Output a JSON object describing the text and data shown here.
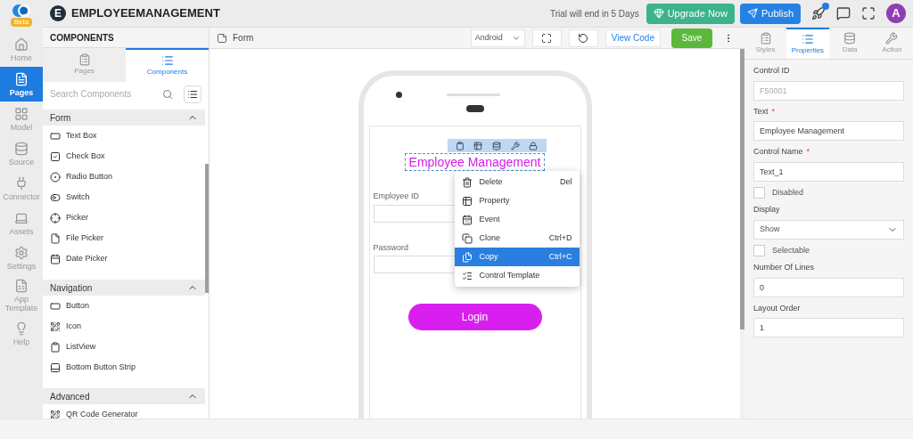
{
  "app": {
    "logo_badge": "Beta",
    "title_initial": "E",
    "title": "EMPLOYEEMANAGEMENT"
  },
  "topbar": {
    "trial_text": "Trial will end in 5 Days",
    "upgrade_button": "Upgrade Now",
    "publish_button": "Publish",
    "notification_dot": true,
    "avatar_initial": "A"
  },
  "nav_rail": [
    {
      "label": "Home",
      "selected": false
    },
    {
      "label": "Pages",
      "selected": true
    },
    {
      "label": "Model",
      "selected": false
    },
    {
      "label": "Source",
      "selected": false
    },
    {
      "label": "Connector",
      "selected": false
    },
    {
      "label": "Assets",
      "selected": false
    },
    {
      "label": "Settings",
      "selected": false
    },
    {
      "label": "App Template",
      "selected": false
    },
    {
      "label": "Help",
      "selected": false
    }
  ],
  "components_panel": {
    "title": "COMPONENTS",
    "tabs": [
      {
        "label": "Pages",
        "selected": false
      },
      {
        "label": "Components",
        "selected": true
      }
    ],
    "search": {
      "placeholder": "Search Components"
    },
    "sections": [
      {
        "title": "Form",
        "expanded": true,
        "items": [
          "Text Box",
          "Check Box",
          "Radio Button",
          "Switch",
          "Picker",
          "File Picker",
          "Date Picker"
        ]
      },
      {
        "title": "Navigation",
        "expanded": true,
        "items": [
          "Button",
          "Icon",
          "ListView",
          "Bottom Button Strip"
        ]
      },
      {
        "title": "Advanced",
        "expanded": true,
        "items": [
          "QR Code Generator"
        ]
      }
    ]
  },
  "canvas": {
    "page_title": "Form",
    "device_select": "Android",
    "view_code_button": "View Code",
    "save_button": "Save",
    "screen": {
      "title": "Employee Management",
      "fields": [
        {
          "label": "Employee ID"
        },
        {
          "label": "Password"
        }
      ],
      "login_button": "Login"
    },
    "context_menu": [
      {
        "label": "Delete",
        "shortcut": "Del",
        "selected": false
      },
      {
        "label": "Property",
        "selected": false
      },
      {
        "label": "Event",
        "selected": false
      },
      {
        "label": "Clone",
        "shortcut": "Ctrl+D",
        "selected": false
      },
      {
        "label": "Copy",
        "shortcut": "Ctrl+C",
        "selected": true
      },
      {
        "label": "Control Template",
        "selected": false
      }
    ]
  },
  "properties_panel": {
    "tabs": [
      {
        "label": "Styles",
        "selected": false
      },
      {
        "label": "Properties",
        "selected": true
      },
      {
        "label": "Data",
        "selected": false
      },
      {
        "label": "Action",
        "selected": false
      }
    ],
    "fields": [
      {
        "kind": "input",
        "label": "Control ID",
        "value": "F50001",
        "disabled": true
      },
      {
        "kind": "input",
        "label": "Text",
        "required_mark": "*",
        "value": "Employee Management",
        "disabled": false
      },
      {
        "kind": "input",
        "label": "Control Name",
        "required_mark": "*",
        "value": "Text_1",
        "disabled": false
      },
      {
        "kind": "checkbox",
        "label": "Disabled",
        "checked": false
      },
      {
        "kind": "select",
        "label": "Display",
        "value": "Show"
      },
      {
        "kind": "checkbox",
        "label": "Selectable",
        "checked": false
      },
      {
        "kind": "input",
        "label": "Number Of Lines",
        "value": "0",
        "disabled": false
      },
      {
        "kind": "input",
        "label": "Layout Order",
        "value": "1",
        "disabled": false
      }
    ]
  }
}
